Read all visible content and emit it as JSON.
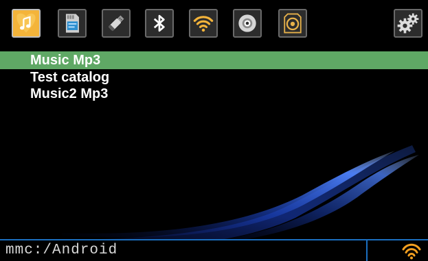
{
  "sources": [
    {
      "name": "music",
      "icon": "music-note-icon",
      "active": true
    },
    {
      "name": "sd-card",
      "icon": "sd-card-icon",
      "active": false
    },
    {
      "name": "usb",
      "icon": "usb-stick-icon",
      "active": false
    },
    {
      "name": "bluetooth",
      "icon": "bluetooth-icon",
      "active": false
    },
    {
      "name": "radio",
      "icon": "wifi-signal-icon",
      "active": false
    },
    {
      "name": "disc",
      "icon": "disc-icon",
      "active": false
    },
    {
      "name": "aux",
      "icon": "aux-disc-icon",
      "active": false
    },
    {
      "name": "settings",
      "icon": "gears-icon",
      "active": false
    }
  ],
  "list": {
    "items": [
      {
        "label": "Music  Mp3",
        "selected": true
      },
      {
        "label": "Test catalog",
        "selected": false
      },
      {
        "label": "Music2 Mp3",
        "selected": false
      }
    ]
  },
  "status": {
    "path": "mmc:/Android",
    "signal_icon": "wifi-signal-icon"
  },
  "colors": {
    "accent_blue": "#1b6fc0",
    "selection_green": "#5fa865",
    "music_icon_bg": "#f4b43a",
    "signal_orange": "#f4a020"
  }
}
